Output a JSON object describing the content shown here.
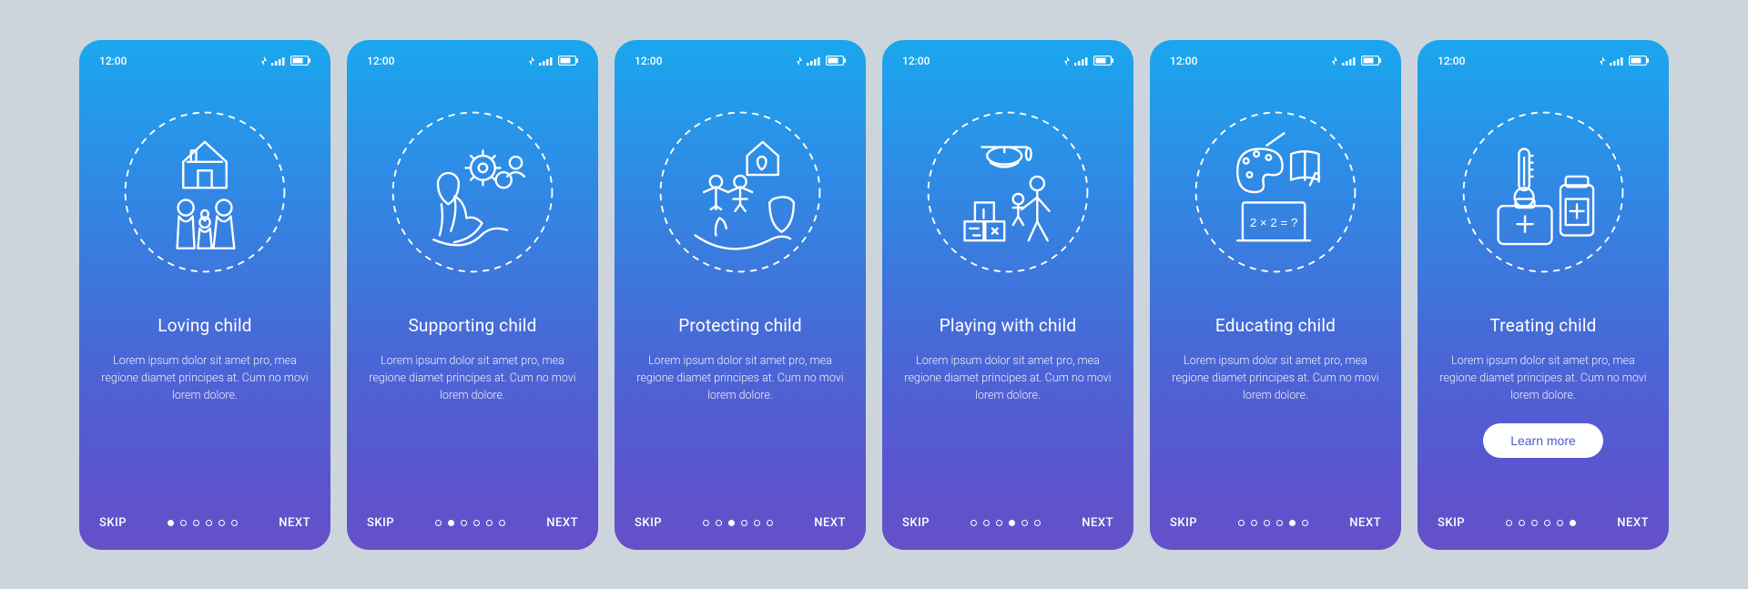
{
  "status": {
    "time": "12:00"
  },
  "nav": {
    "skip": "SKIP",
    "next": "NEXT"
  },
  "learn_more": "Learn more",
  "description": "Lorem ipsum dolor sit amet pro, mea regione diamet principes at. Cum no movi lorem dolore.",
  "screens": [
    {
      "title": "Loving child",
      "has_learn_more": false
    },
    {
      "title": "Supporting child",
      "has_learn_more": false
    },
    {
      "title": "Protecting child",
      "has_learn_more": false
    },
    {
      "title": "Playing with child",
      "has_learn_more": false
    },
    {
      "title": "Educating child",
      "has_learn_more": false
    },
    {
      "title": "Treating child",
      "has_learn_more": true
    }
  ]
}
